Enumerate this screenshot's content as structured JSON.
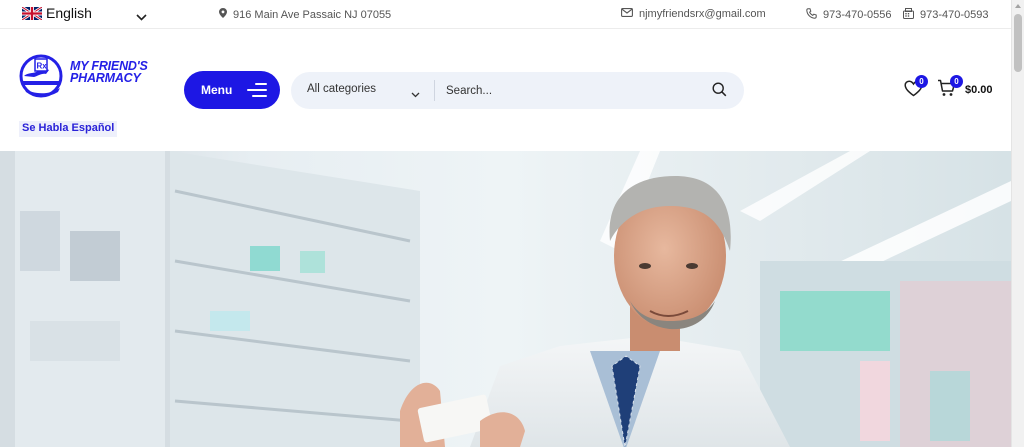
{
  "topbar": {
    "language": "English",
    "address": "916 Main Ave Passaic NJ 07055",
    "email": "njmyfriendsrx@gmail.com",
    "phone": "973-470-0556",
    "fax": "973-470-0593"
  },
  "header": {
    "logo_line1": "MY FRIEND'S",
    "logo_line2": "PHARMACY",
    "logo_rx": "Rx",
    "tagline": "Se Habla Español",
    "menu_label": "Menu"
  },
  "search": {
    "category": "All categories",
    "placeholder": "Search..."
  },
  "actions": {
    "wishlist_count": "0",
    "cart_count": "0",
    "cart_total": "$0.00"
  },
  "colors": {
    "brand": "#1d17e4",
    "search_bg": "#eef2f9"
  },
  "icons": [
    "flag-uk-icon",
    "chevron-down-icon",
    "map-pin-icon",
    "mail-icon",
    "phone-icon",
    "fax-icon",
    "menu-lines-icon",
    "search-icon",
    "heart-icon",
    "cart-icon"
  ]
}
